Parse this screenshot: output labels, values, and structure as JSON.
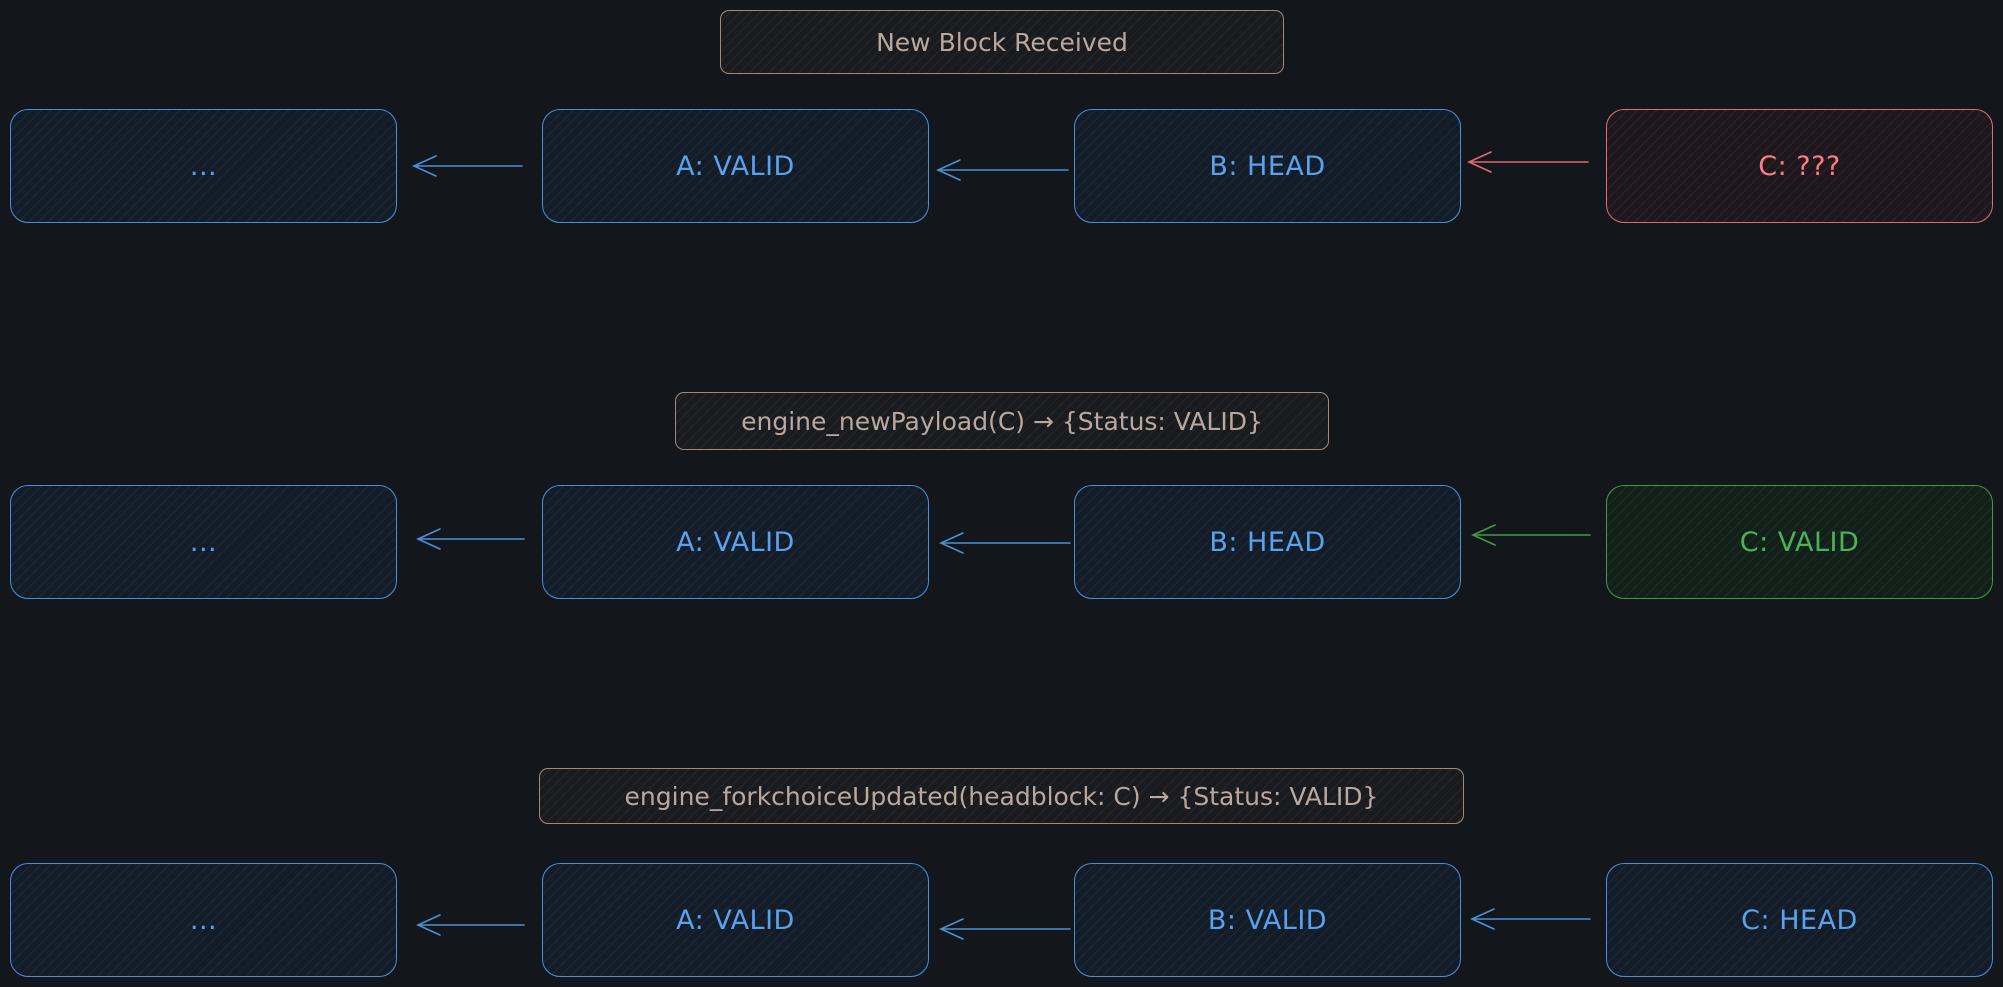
{
  "colors": {
    "background": "#13161b",
    "blue": "#4a90d9",
    "red": "#e06a75",
    "green": "#3f9a4a",
    "label": "#a08a80"
  },
  "rows": [
    {
      "label": "New Block Received",
      "blocks": [
        {
          "text": "...",
          "color": "blue"
        },
        {
          "text": "A: VALID",
          "color": "blue"
        },
        {
          "text": "B: HEAD",
          "color": "blue"
        },
        {
          "text": "C: ???",
          "color": "red"
        }
      ]
    },
    {
      "label": "engine_newPayload(C) → {Status: VALID}",
      "blocks": [
        {
          "text": "...",
          "color": "blue"
        },
        {
          "text": "A: VALID",
          "color": "blue"
        },
        {
          "text": "B: HEAD",
          "color": "blue"
        },
        {
          "text": "C: VALID",
          "color": "green"
        }
      ]
    },
    {
      "label": "engine_forkchoiceUpdated(headblock: C) → {Status: VALID}",
      "blocks": [
        {
          "text": "...",
          "color": "blue"
        },
        {
          "text": "A: VALID",
          "color": "blue"
        },
        {
          "text": "B: VALID",
          "color": "blue"
        },
        {
          "text": "C: HEAD",
          "color": "blue"
        }
      ]
    }
  ]
}
